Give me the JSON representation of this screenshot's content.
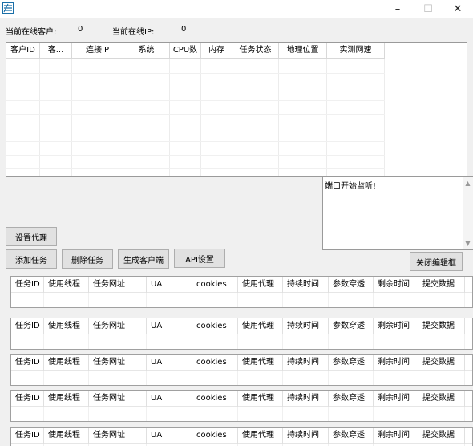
{
  "window": {
    "minimize": "–",
    "maximize": "☐",
    "close": "✕",
    "icon": "app-icon"
  },
  "status": {
    "online_clients_label": "当前在线客户:",
    "online_clients_value": "0",
    "online_ip_label": "当前在线IP:",
    "online_ip_value": "0"
  },
  "client_table": {
    "columns": [
      "客户ID",
      "客...",
      "连接IP",
      "系统",
      "CPU数",
      "内存",
      "任务状态",
      "地理位置",
      "实测网速"
    ],
    "rows": []
  },
  "log": {
    "text": "端口开始监听!"
  },
  "buttons": {
    "set_proxy": "设置代理",
    "add_task": "添加任务",
    "delete_task": "删除任务",
    "generate_client": "生成客户端",
    "api_settings": "API设置",
    "close_edit_box": "关闭编辑框"
  },
  "task_panels": [
    {
      "columns": [
        "任务ID",
        "使用线程",
        "任务网址",
        "UA",
        "cookies",
        "使用代理",
        "持续时间",
        "参数穿透",
        "剩余时间",
        "提交数据"
      ]
    },
    {
      "columns": [
        "任务ID",
        "使用线程",
        "任务网址",
        "UA",
        "cookies",
        "使用代理",
        "持续时间",
        "参数穿透",
        "剩余时间",
        "提交数据"
      ]
    },
    {
      "columns": [
        "任务ID",
        "使用线程",
        "任务网址",
        "UA",
        "cookies",
        "使用代理",
        "持续时间",
        "参数穿透",
        "剩余时间",
        "提交数据"
      ]
    },
    {
      "columns": [
        "任务ID",
        "使用线程",
        "任务网址",
        "UA",
        "cookies",
        "使用代理",
        "持续时间",
        "参数穿透",
        "剩余时间",
        "提交数据"
      ]
    },
    {
      "columns": [
        "任务ID",
        "使用线程",
        "任务网址",
        "UA",
        "cookies",
        "使用代理",
        "持续时间",
        "参数穿透",
        "剩余时间",
        "提交数据"
      ]
    }
  ]
}
